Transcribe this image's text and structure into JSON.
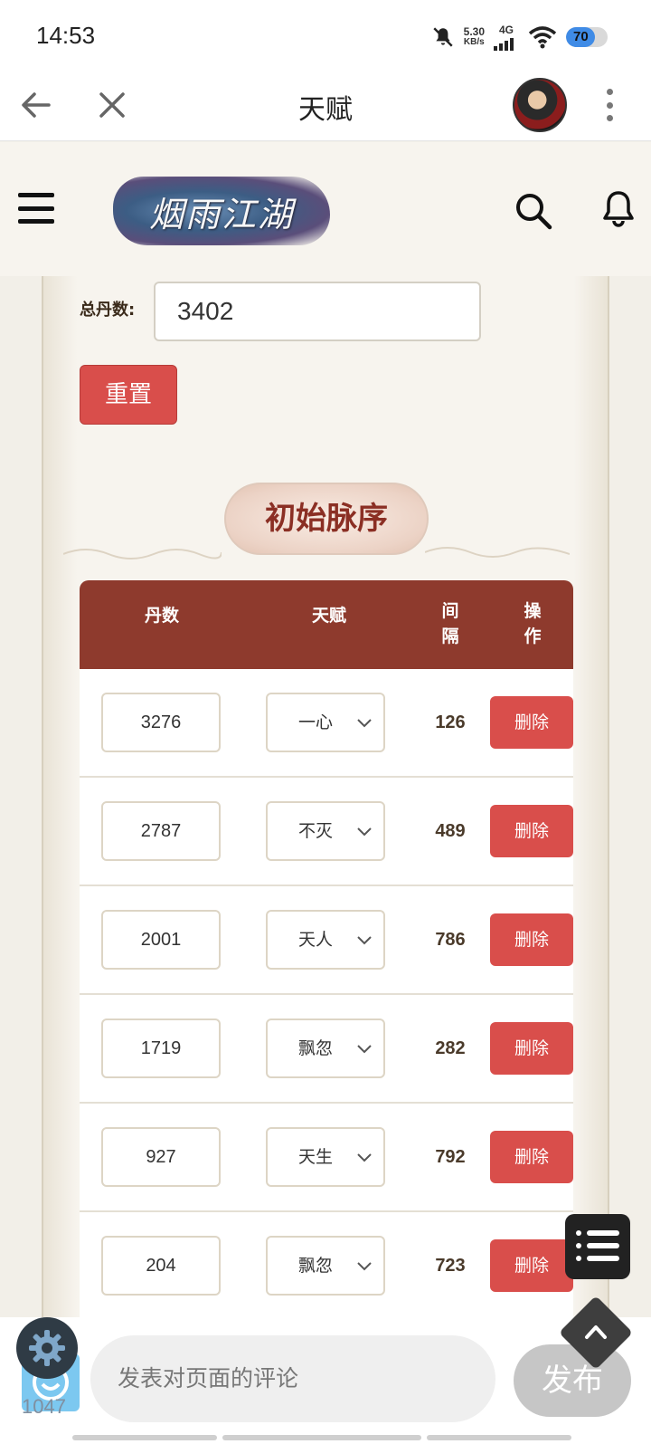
{
  "status_bar": {
    "time": "14:53",
    "speed_value": "5.30",
    "speed_unit": "KB/s",
    "network": "4G",
    "battery": "70",
    "battery_level": 0.7
  },
  "app_bar": {
    "title": "天赋"
  },
  "site": {
    "logo_text": "烟雨江湖"
  },
  "form": {
    "total_label": "总丹数:",
    "total_value": "3402",
    "reset_label": "重置"
  },
  "section": {
    "title": "初始脉序"
  },
  "table": {
    "headers": {
      "dan": "丹数",
      "talent": "天赋",
      "gap_1": "间",
      "gap_2": "隔",
      "op_1": "操",
      "op_2": "作"
    },
    "rows": [
      {
        "dan": "3276",
        "talent": "一心",
        "gap": "126",
        "action": "删除"
      },
      {
        "dan": "2787",
        "talent": "不灭",
        "gap": "489",
        "action": "删除"
      },
      {
        "dan": "2001",
        "talent": "天人",
        "gap": "786",
        "action": "删除"
      },
      {
        "dan": "1719",
        "talent": "飘忽",
        "gap": "282",
        "action": "删除"
      },
      {
        "dan": "927",
        "talent": "天生",
        "gap": "792",
        "action": "删除"
      },
      {
        "dan": "204",
        "talent": "飘忽",
        "gap": "723",
        "action": "删除"
      }
    ]
  },
  "bottom_bar": {
    "badge_count": "1047",
    "comment_placeholder": "发表对页面的评论",
    "publish_label": "发布"
  },
  "colors": {
    "accent_red": "#d94e4b",
    "header_brown": "#8e3a2d",
    "section_text": "#8b2f24"
  }
}
